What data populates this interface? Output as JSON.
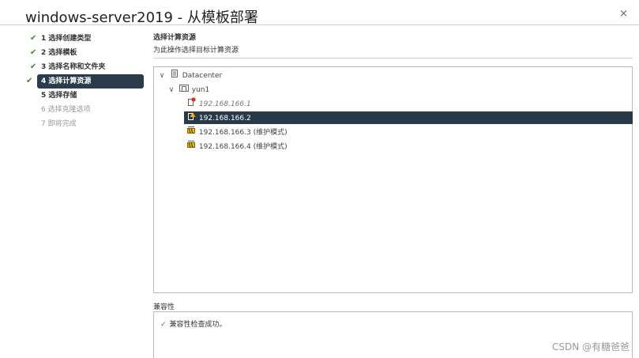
{
  "dialog": {
    "title": "windows-server2019 - 从模板部署",
    "close_glyph": "×"
  },
  "steps": [
    {
      "label": "1 选择创建类型",
      "state": "done"
    },
    {
      "label": "2 选择模板",
      "state": "done"
    },
    {
      "label": "3 选择名称和文件夹",
      "state": "done"
    },
    {
      "label": "4 选择计算资源",
      "state": "active"
    },
    {
      "label": "5 选择存储",
      "state": "enabled"
    },
    {
      "label": "6 选择克隆选项",
      "state": "disabled"
    },
    {
      "label": "7 即将完成",
      "state": "disabled"
    }
  ],
  "step_check_glyph": "✔",
  "main": {
    "heading": "选择计算资源",
    "subheading": "为此操作选择目标计算资源"
  },
  "tree": {
    "datacenter": {
      "label": "Datacenter",
      "icon": "datacenter-icon",
      "chevron": "∨"
    },
    "cluster": {
      "label": "yun1",
      "icon": "cluster-icon",
      "chevron": "∨"
    },
    "hosts": [
      {
        "label": "192.168.166.1",
        "icon": "host-error-icon",
        "state": "error"
      },
      {
        "label": "192.168.166.2",
        "icon": "host-warning-icon",
        "state": "selected"
      },
      {
        "label": "192.168.166.3 (维护模式)",
        "icon": "host-maintenance-icon",
        "state": "maintenance"
      },
      {
        "label": "192.168.166.4 (维护模式)",
        "icon": "host-maintenance-icon",
        "state": "maintenance"
      }
    ]
  },
  "compat": {
    "label": "兼容性",
    "message": "兼容性检查成功。",
    "ok_glyph": "✓"
  },
  "watermark": "CSDN @有糖爸爸",
  "colors": {
    "accent_dark": "#283a4a",
    "success": "#3a8c2a",
    "error": "#e0301e",
    "warning": "#f0b400"
  }
}
